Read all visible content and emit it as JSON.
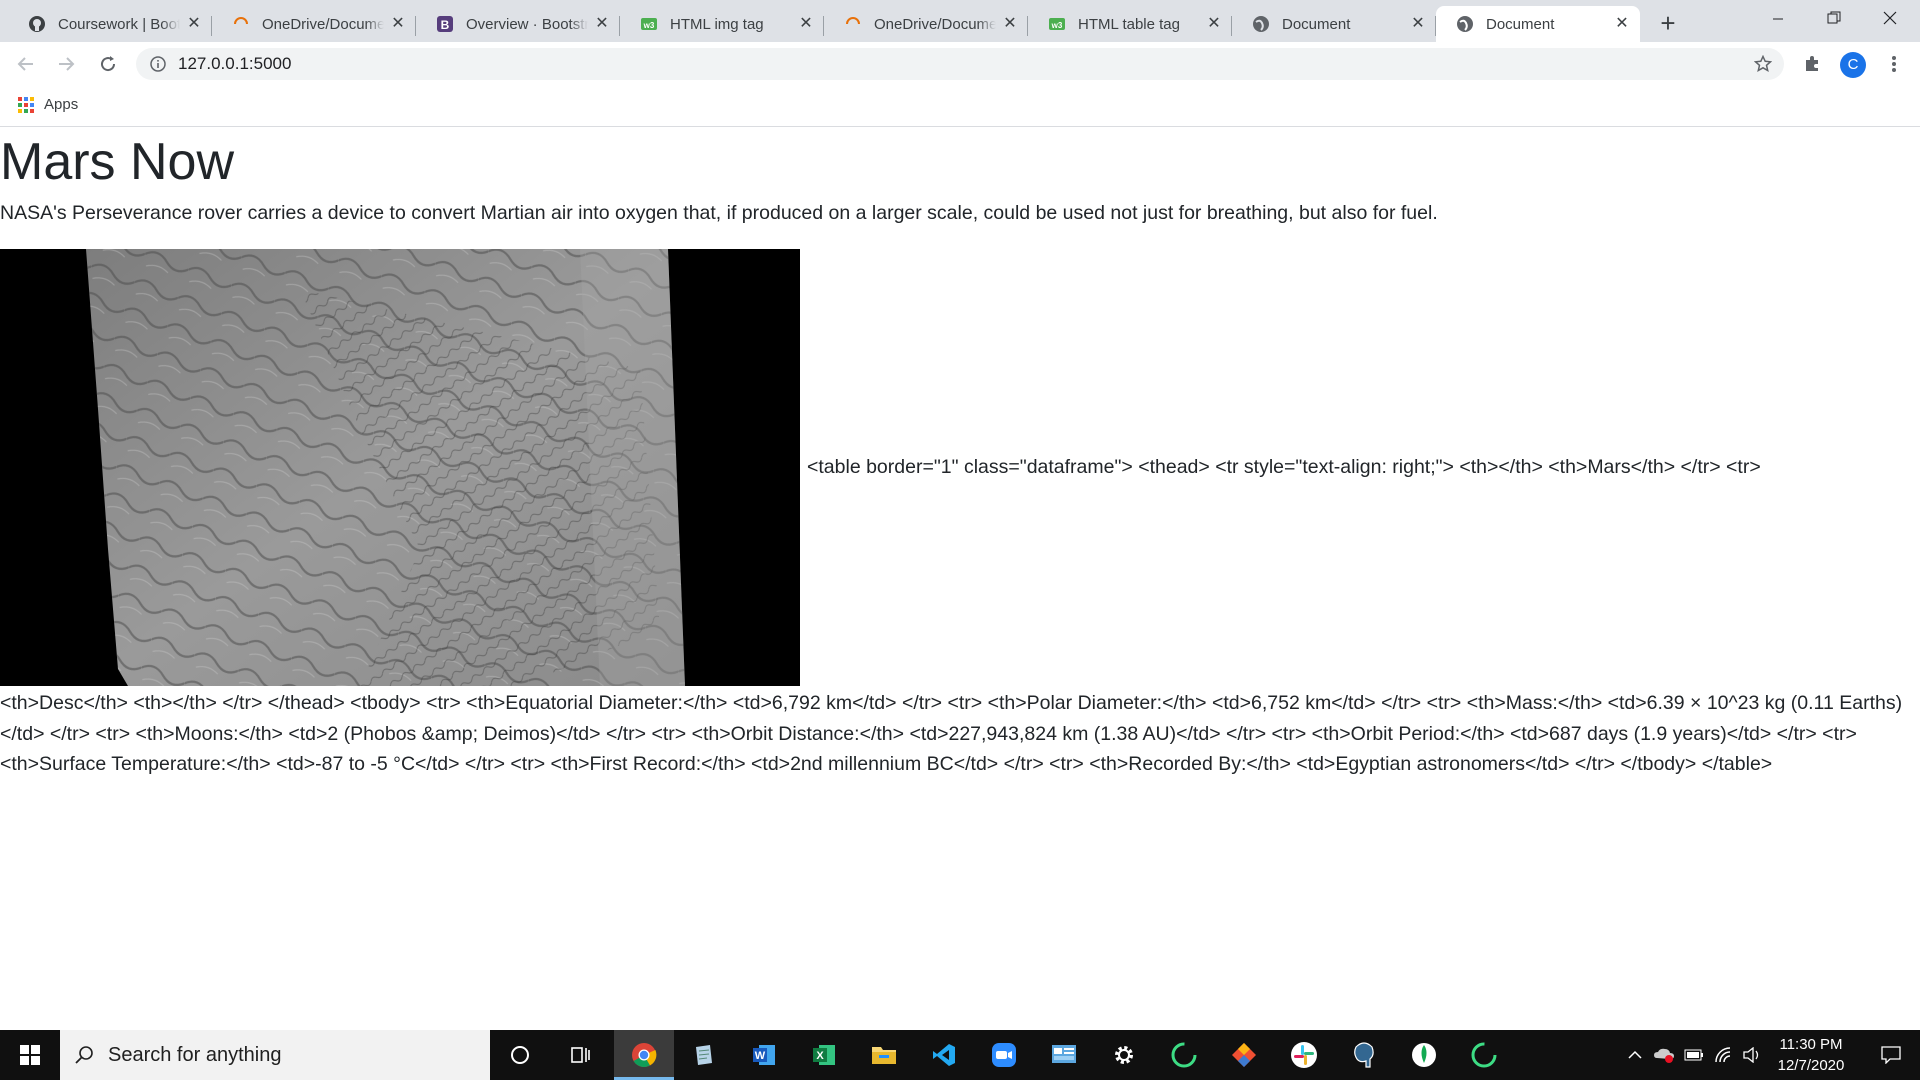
{
  "browser": {
    "tabs": [
      {
        "title": "Coursework | Boot",
        "icon": "github-icon"
      },
      {
        "title": "OneDrive/Docume",
        "icon": "onedrive-loading-icon"
      },
      {
        "title": "Overview · Bootstr",
        "icon": "bootstrap-icon"
      },
      {
        "title": "HTML img tag",
        "icon": "w3schools-icon"
      },
      {
        "title": "OneDrive/Docume",
        "icon": "onedrive-loading-icon"
      },
      {
        "title": "HTML table tag",
        "icon": "w3schools-icon"
      },
      {
        "title": "Document",
        "icon": "globe-icon"
      },
      {
        "title": "Document",
        "icon": "globe-icon",
        "active": true
      }
    ],
    "close_glyph": "✕",
    "new_tab_glyph": "+",
    "url": "127.0.0.1:5000",
    "profile_initial": "C",
    "bookmarks": {
      "apps_label": "Apps"
    }
  },
  "page": {
    "title": "Mars Now",
    "description": "NASA's Perseverance rover carries a device to convert Martian air into oxygen that, if produced on a larger scale, could be used not just for breathing, but also for fuel.",
    "inline_html": "<table border=\"1\" class=\"dataframe\"> <thead> <tr style=\"text-align: right;\"> <th></th> <th>Mars</th> </tr> <tr>",
    "raw_html": "<th>Desc</th> <th></th> </tr> </thead> <tbody> <tr> <th>Equatorial Diameter:</th> <td>6,792 km</td> </tr> <tr> <th>Polar Diameter:</th> <td>6,752 km</td> </tr> <tr> <th>Mass:</th> <td>6.39 × 10^23 kg (0.11 Earths)</td> </tr> <tr> <th>Moons:</th> <td>2 (Phobos &amp; Deimos)</td> </tr> <tr> <th>Orbit Distance:</th> <td>227,943,824 km (1.38 AU)</td> </tr> <tr> <th>Orbit Period:</th> <td>687 days (1.9 years)</td> </tr> <tr> <th>Surface Temperature:</th> <td>-87 to -5 °C</td> </tr> <tr> <th>First Record:</th> <td>2nd millennium BC</td> </tr> <tr> <th>Recorded By:</th> <td>Egyptian astronomers</td> </tr> </tbody> </table>"
  },
  "taskbar": {
    "search_placeholder": "Search for anything",
    "apps": [
      "cortana-icon",
      "task-view-icon",
      "chrome-icon",
      "notepad-icon",
      "word-icon",
      "excel-icon",
      "file-explorer-icon",
      "vscode-icon",
      "zoom-icon",
      "control-panel-icon",
      "settings-icon",
      "loading-ring-icon",
      "git-icon",
      "slack-icon",
      "postgres-icon",
      "mongodb-icon",
      "loading-ring-icon"
    ],
    "time": "11:30 PM",
    "date": "12/7/2020"
  },
  "colors": {
    "tab_strip": "#dee1e6",
    "page_text": "#212529",
    "taskbar": "#101010",
    "accent": "#1a73e8"
  }
}
